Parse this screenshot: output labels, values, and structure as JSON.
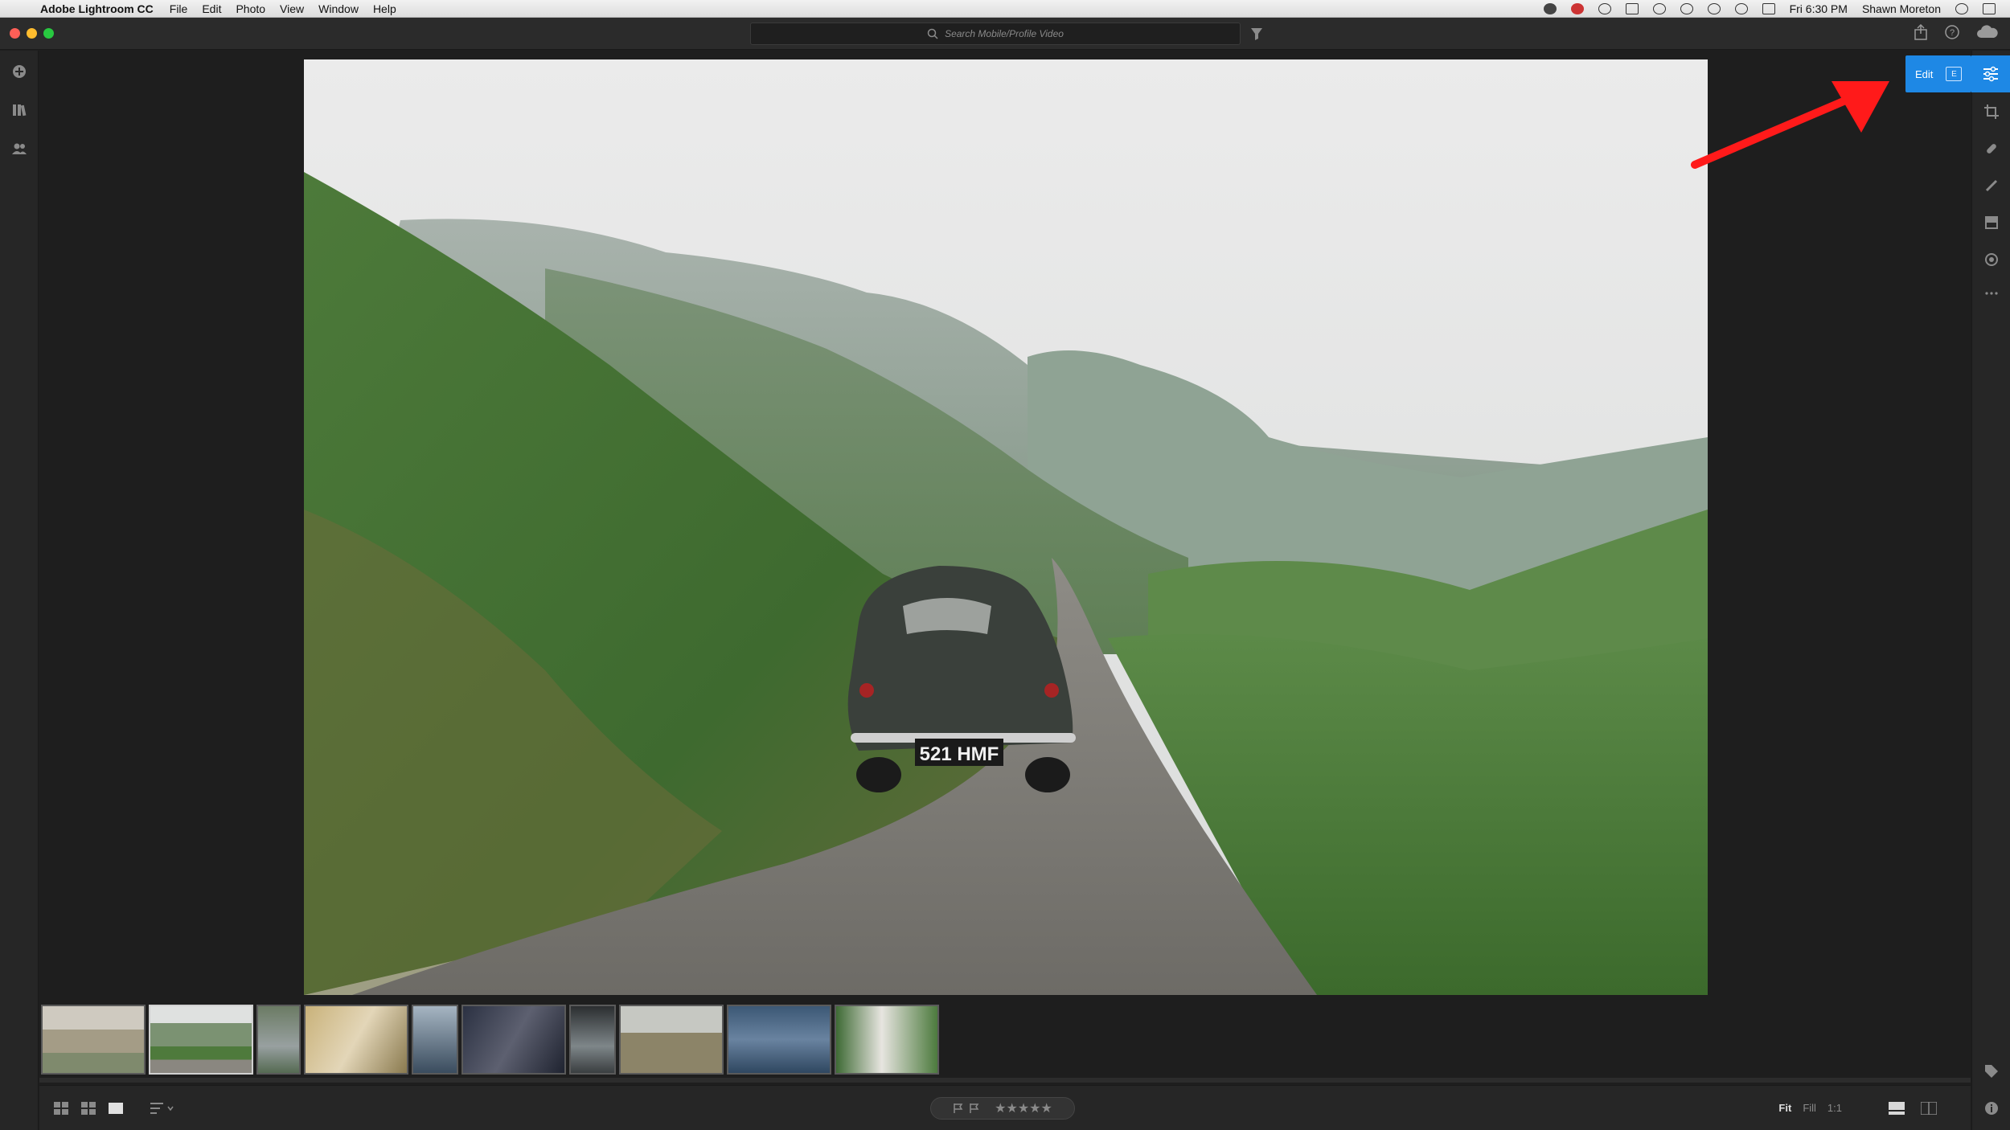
{
  "menubar": {
    "app_name": "Adobe Lightroom CC",
    "menus": [
      "File",
      "Edit",
      "Photo",
      "View",
      "Window",
      "Help"
    ],
    "clock": "Fri 6:30 PM",
    "user": "Shawn Moreton"
  },
  "toolbar": {
    "search_placeholder": "Search Mobile/Profile Video"
  },
  "edit_panel": {
    "label": "Edit",
    "shortcut": "E"
  },
  "photo": {
    "license_plate": "521 HMF"
  },
  "filmstrip": {
    "thumbnail_count": 10,
    "selected_index": 1
  },
  "bottombar": {
    "zoom_options": [
      "Fit",
      "Fill",
      "1:1"
    ],
    "active_zoom": "Fit",
    "stars": "★★★★★"
  },
  "colors": {
    "accent": "#1e88e5",
    "annotation_arrow": "#ff1a1a",
    "panel_bg": "#262626",
    "canvas_bg": "#1e1e1e"
  }
}
